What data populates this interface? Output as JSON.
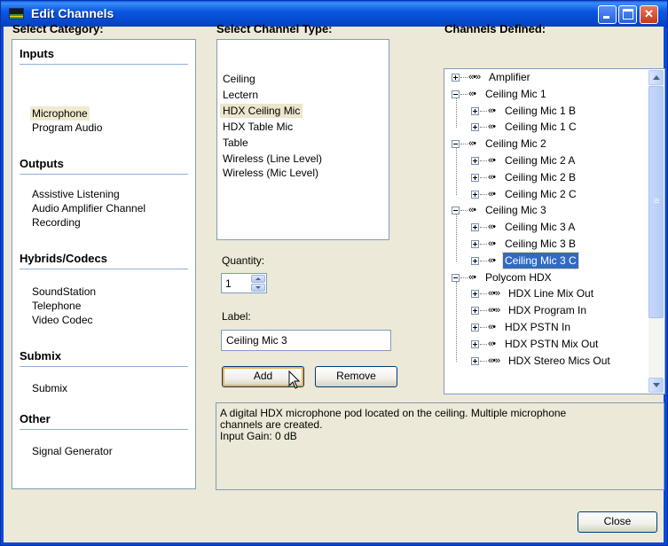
{
  "window": {
    "title": "Edit Channels"
  },
  "titlebar_buttons": {
    "minimize": "minimize",
    "maximize": "maximize",
    "close": "✕"
  },
  "category": {
    "heading": "Select Category:",
    "groups": [
      {
        "title": "Inputs",
        "items": [
          "Microphone",
          "Program Audio"
        ]
      },
      {
        "title": "Outputs",
        "items": [
          "Assistive Listening",
          "Audio Amplifier Channel",
          "Recording"
        ]
      },
      {
        "title": "Hybrids/Codecs",
        "items": [
          "SoundStation",
          "Telephone",
          "Video Codec"
        ]
      },
      {
        "title": "Submix",
        "items": [
          "Submix"
        ]
      },
      {
        "title": "Other",
        "items": [
          "Signal Generator"
        ]
      }
    ],
    "selected": "Microphone"
  },
  "channel_type": {
    "heading": "Select Channel Type:",
    "items": [
      "Ceiling",
      "Lectern",
      "HDX Ceiling Mic",
      "HDX Table Mic",
      "Table",
      "Wireless (Line Level)",
      "Wireless (Mic Level)"
    ],
    "selected": "HDX Ceiling Mic"
  },
  "quantity": {
    "label": "Quantity:",
    "value": "1"
  },
  "label_field": {
    "label": "Label:",
    "value": "Ceiling Mic 3"
  },
  "buttons": {
    "add": "Add",
    "remove": "Remove",
    "close": "Close"
  },
  "channels": {
    "heading": "Channels Defined:",
    "rows": [
      {
        "level": 0,
        "expander": "plus",
        "icon": "«•»",
        "label": "Amplifier"
      },
      {
        "level": 0,
        "expander": "minus",
        "icon": "«•",
        "label": "Ceiling Mic 1"
      },
      {
        "level": 1,
        "expander": "plus",
        "icon": "«•",
        "label": "Ceiling Mic 1 B"
      },
      {
        "level": 1,
        "expander": "plus",
        "icon": "«•",
        "label": "Ceiling Mic 1 C"
      },
      {
        "level": 0,
        "expander": "minus",
        "icon": "«•",
        "label": "Ceiling Mic 2"
      },
      {
        "level": 1,
        "expander": "plus",
        "icon": "«•",
        "label": "Ceiling Mic 2 A"
      },
      {
        "level": 1,
        "expander": "plus",
        "icon": "«•",
        "label": "Ceiling Mic 2 B"
      },
      {
        "level": 1,
        "expander": "plus",
        "icon": "«•",
        "label": "Ceiling Mic 2 C"
      },
      {
        "level": 0,
        "expander": "minus",
        "icon": "«•",
        "label": "Ceiling Mic 3"
      },
      {
        "level": 1,
        "expander": "plus",
        "icon": "«•",
        "label": "Ceiling Mic 3 A"
      },
      {
        "level": 1,
        "expander": "plus",
        "icon": "«•",
        "label": "Ceiling Mic 3 B"
      },
      {
        "level": 1,
        "expander": "plus",
        "icon": "«•",
        "label": "Ceiling Mic 3 C",
        "selected": true
      },
      {
        "level": 0,
        "expander": "minus",
        "icon": "«•",
        "label": "Polycom HDX"
      },
      {
        "level": 1,
        "expander": "plus",
        "icon": "«•»",
        "label": "HDX Line Mix Out"
      },
      {
        "level": 1,
        "expander": "plus",
        "icon": "«•»",
        "label": "HDX Program In"
      },
      {
        "level": 1,
        "expander": "plus",
        "icon": "«•",
        "label": "HDX PSTN In"
      },
      {
        "level": 1,
        "expander": "plus",
        "icon": "«•",
        "label": "HDX PSTN Mix Out"
      },
      {
        "level": 1,
        "expander": "plus",
        "icon": "«•»",
        "label": "HDX Stereo Mics Out"
      }
    ]
  },
  "description": {
    "lines": [
      "A digital HDX microphone pod located on the ceiling.  Multiple microphone",
      "channels are created.",
      "Input Gain: 0 dB"
    ]
  },
  "colors": {
    "titlebar": "#0a57e0",
    "face": "#ece9d8",
    "selection": "#316ac5",
    "border": "#7f9db9"
  }
}
